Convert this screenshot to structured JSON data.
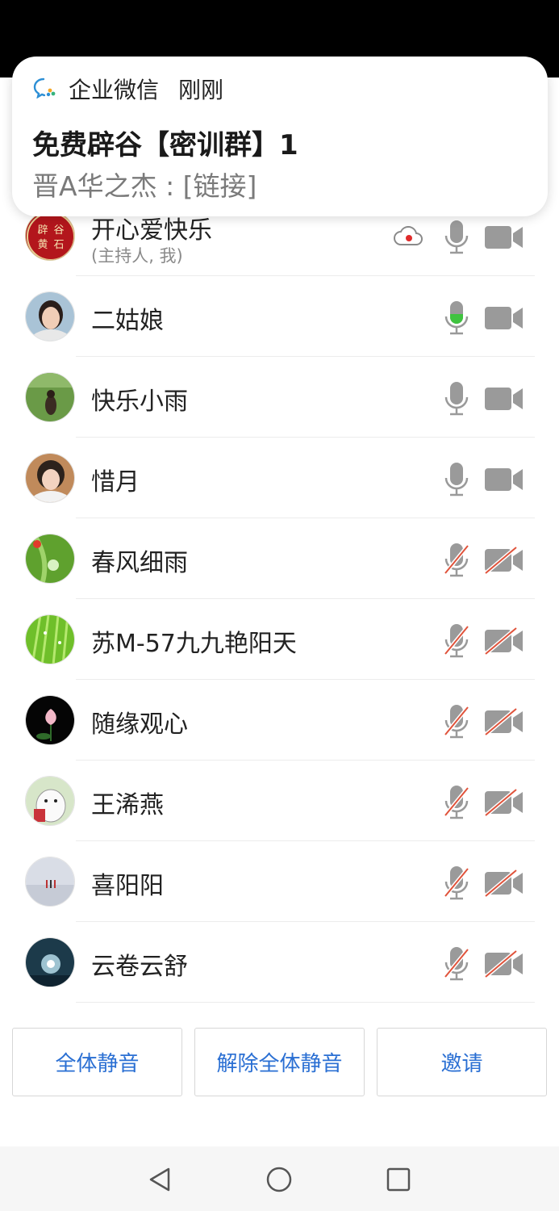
{
  "notification": {
    "app_name": "企业微信",
    "time": "刚刚",
    "title": "免费辟谷【密训群】1",
    "body": "晋A华之杰 : [链接]"
  },
  "members": [
    {
      "name": "开心爱快乐",
      "sub": "(主持人, 我)",
      "avatar_text": [
        "辟",
        "谷",
        "黄",
        "石"
      ],
      "mic": "on",
      "cam": "on",
      "recording": true
    },
    {
      "name": "二姑娘",
      "mic": "speaking",
      "cam": "on"
    },
    {
      "name": "快乐小雨",
      "mic": "on",
      "cam": "on"
    },
    {
      "name": "惜月",
      "mic": "on",
      "cam": "on"
    },
    {
      "name": "春风细雨",
      "mic": "muted",
      "cam": "off"
    },
    {
      "name": "苏M-57九九艳阳天",
      "mic": "muted",
      "cam": "off"
    },
    {
      "name": "随缘观心",
      "mic": "muted",
      "cam": "off"
    },
    {
      "name": "王浠燕",
      "mic": "muted",
      "cam": "off"
    },
    {
      "name": "喜阳阳",
      "mic": "muted",
      "cam": "off"
    },
    {
      "name": "云卷云舒",
      "mic": "muted",
      "cam": "off"
    }
  ],
  "actions": {
    "mute_all": "全体静音",
    "unmute_all": "解除全体静音",
    "invite": "邀请"
  },
  "colors": {
    "accent": "#2a6fd3",
    "speaking": "#3fc33f",
    "muted_slash": "#e0533b",
    "icon_gray": "#9a9a9a"
  }
}
